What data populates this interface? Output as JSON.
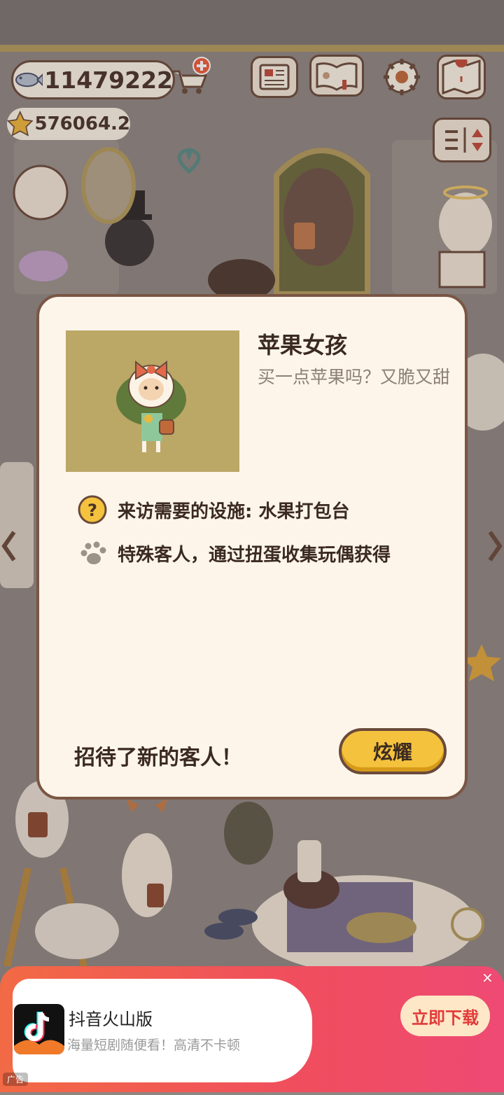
{
  "hud": {
    "coins": "11479222",
    "stars": "576064.2",
    "icons": [
      "fish-icon",
      "cart-plus-icon",
      "star-icon",
      "newspaper-icon",
      "paw-book-icon",
      "settings-gear-icon",
      "map-icon",
      "sort-icon"
    ]
  },
  "dialog": {
    "character_name": "苹果女孩",
    "character_desc": "买一点苹果吗？又脆又甜",
    "requirement_label": "来访需要的设施: 水果打包台",
    "special_note": "特殊客人，通过扭蛋收集玩偶获得",
    "footer_message": "招待了新的客人！",
    "show_button": "炫耀"
  },
  "ad": {
    "app_name": "抖音火山版",
    "subtitle": "海量短剧随便看！高清不卡顿",
    "download_button": "立即下载",
    "close_symbol": "×",
    "ad_label": "广告"
  },
  "colors": {
    "modal_bg": "#fdf5ea",
    "modal_border": "#7a5644",
    "button_yellow": "#f4c23d",
    "ad_gradient_start": "#f26a45",
    "ad_gradient_end": "#ee4a74"
  }
}
